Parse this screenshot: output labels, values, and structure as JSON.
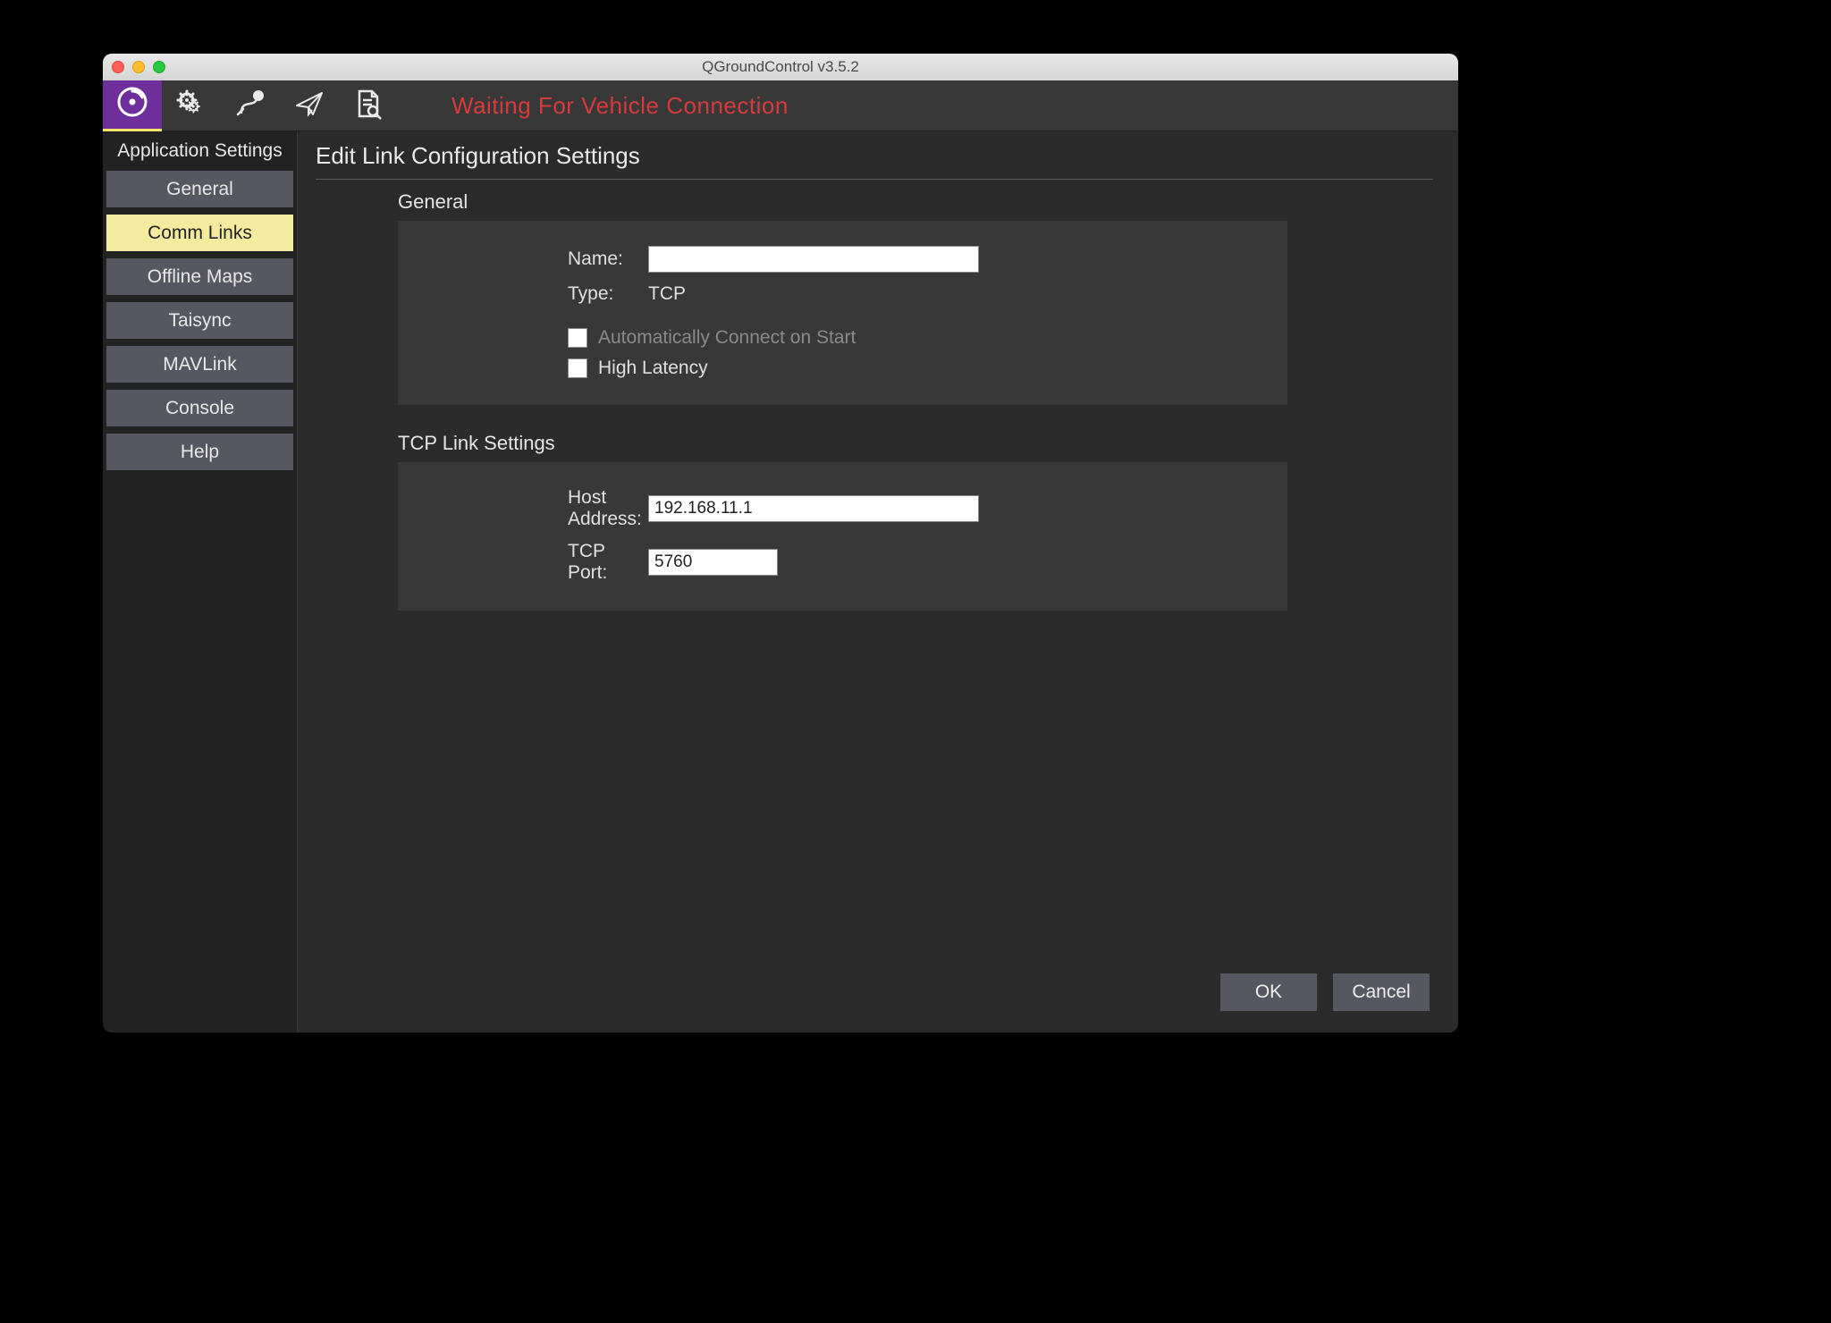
{
  "window": {
    "title": "QGroundControl v3.5.2"
  },
  "toolbar": {
    "status": "Waiting For Vehicle Connection"
  },
  "sidebar": {
    "title": "Application Settings",
    "items": [
      {
        "label": "General"
      },
      {
        "label": "Comm Links"
      },
      {
        "label": "Offline Maps"
      },
      {
        "label": "Taisync"
      },
      {
        "label": "MAVLink"
      },
      {
        "label": "Console"
      },
      {
        "label": "Help"
      }
    ]
  },
  "main": {
    "page_title": "Edit Link Configuration Settings",
    "general": {
      "heading": "General",
      "name_label": "Name:",
      "name_value": "",
      "type_label": "Type:",
      "type_value": "TCP",
      "auto_connect_label": "Automatically Connect on Start",
      "high_latency_label": "High Latency"
    },
    "tcp": {
      "heading": "TCP Link Settings",
      "host_label": "Host Address:",
      "host_value": "192.168.11.1",
      "port_label": "TCP Port:",
      "port_value": "5760"
    },
    "buttons": {
      "ok": "OK",
      "cancel": "Cancel"
    }
  }
}
